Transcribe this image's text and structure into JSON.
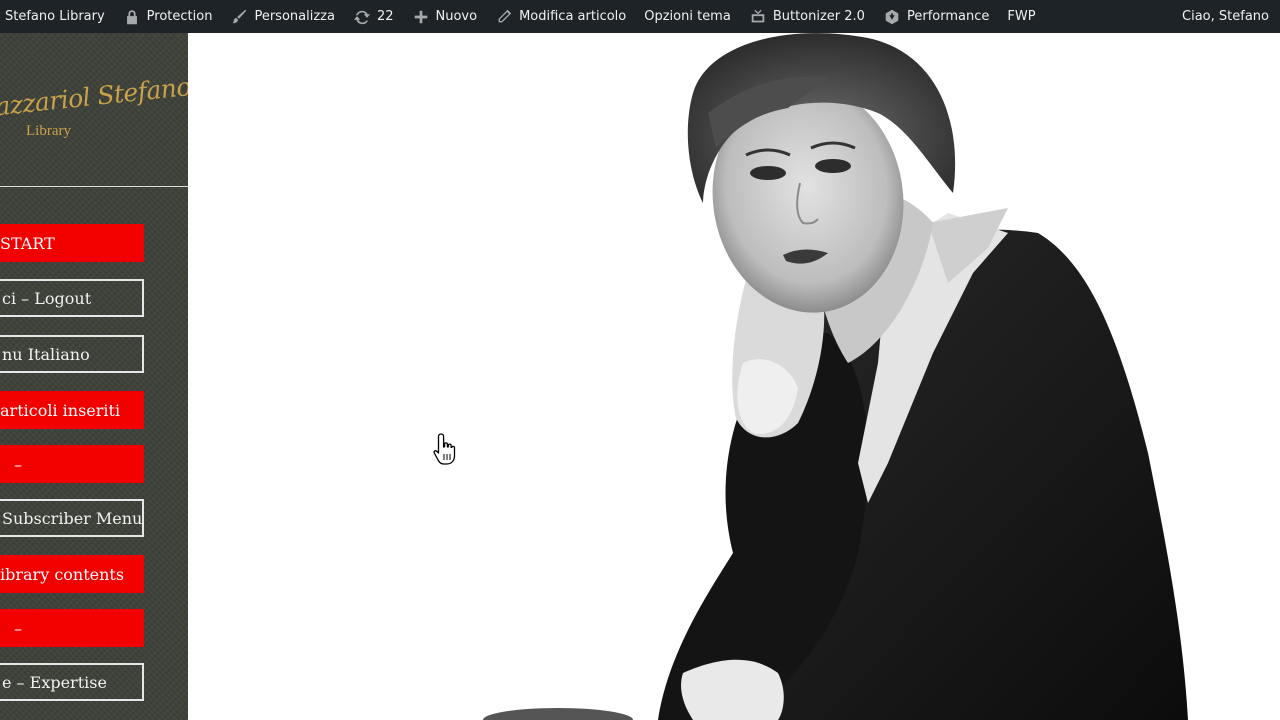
{
  "adminbar": {
    "items": [
      {
        "label": "Stefano Library",
        "icon": ""
      },
      {
        "label": "Protection",
        "icon": "lock-icon"
      },
      {
        "label": "Personalizza",
        "icon": "brush-icon"
      },
      {
        "label": "22",
        "icon": "refresh-icon"
      },
      {
        "label": "Nuovo",
        "icon": "plus-icon"
      },
      {
        "label": "Modifica articolo",
        "icon": "pencil-icon"
      },
      {
        "label": "Opzioni tema",
        "icon": ""
      },
      {
        "label": "Buttonizer 2.0",
        "icon": "buttonizer-icon"
      },
      {
        "label": "Performance",
        "icon": "performance-icon"
      },
      {
        "label": "FWP",
        "icon": ""
      }
    ],
    "greeting": "Ciao, Stefano"
  },
  "sidebar": {
    "logo": {
      "script": "Zazzariol Stefano",
      "subtitle": "Library"
    },
    "colors": {
      "red": "#f20000",
      "outline": "#e6e6e6",
      "gold": "#c9a24c",
      "background": "#3d4138"
    },
    "buttons": [
      {
        "label": "START",
        "style": "red"
      },
      {
        "label": "ci – Logout",
        "style": "outline"
      },
      {
        "label": "nu Italiano",
        "style": "outline"
      },
      {
        "label": "articoli inseriti",
        "style": "red"
      },
      {
        "label": "–",
        "style": "red"
      },
      {
        "label": "Subscriber Menu",
        "style": "outline"
      },
      {
        "label": "ibrary contents",
        "style": "red"
      },
      {
        "label": "–",
        "style": "red"
      },
      {
        "label": "e – Expertise",
        "style": "outline"
      }
    ]
  }
}
